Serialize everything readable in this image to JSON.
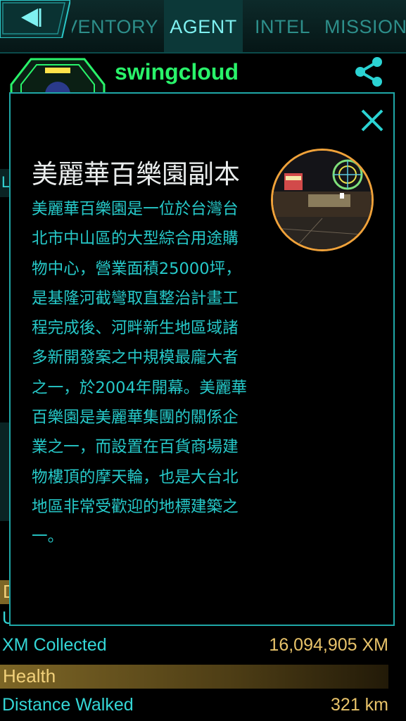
{
  "tabs": [
    {
      "label": "INVENTORY",
      "active": false
    },
    {
      "label": "AGENT",
      "active": true
    },
    {
      "label": "INTEL",
      "active": false
    },
    {
      "label": "MISSIONS",
      "active": false
    }
  ],
  "agent": {
    "name": "swingcloud"
  },
  "colors": {
    "teal": "#26c9c9",
    "agent_green": "#29f36a",
    "gold": "#e8c36a",
    "photo_ring": "#f0a23a"
  },
  "icons": {
    "back": "back-arrow-icon",
    "share": "share-icon",
    "close": "close-icon",
    "level": "level-badge-icon"
  },
  "background_stats": {
    "partial_row_1": "D",
    "partial_row_2": "U",
    "xm_collected_label": "XM Collected",
    "xm_collected_value": "16,094,905 XM",
    "health_label": "Health",
    "distance_label": "Distance Walked",
    "distance_value": "321 km"
  },
  "portal": {
    "title": "美麗華百樂園副本",
    "description": "美麗華百樂園是一位於台灣台北市中山區的大型綜合用途購物中心，營業面積25000坪，是基隆河截彎取直整治計畫工程完成後、河畔新生地區域諸多新開發案之中規模最龐大者之一，於2004年開幕。美麗華百樂園是美麗華集團的關係企業之一，而設置在百貨商場建物樓頂的摩天輪，也是大台北地區非常受歡迎的地標建築之一。"
  }
}
